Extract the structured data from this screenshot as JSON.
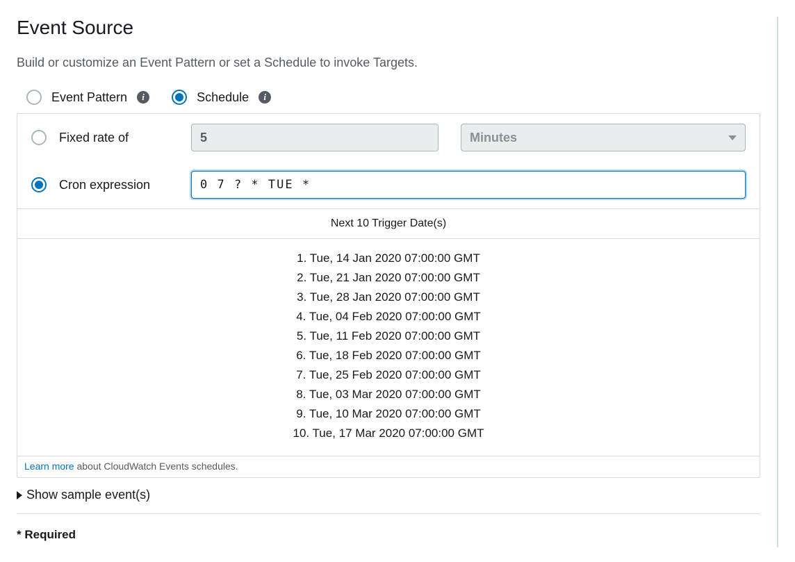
{
  "title": "Event Source",
  "description": "Build or customize an Event Pattern or set a Schedule to invoke Targets.",
  "sourceType": {
    "eventPattern": {
      "label": "Event Pattern",
      "selected": false
    },
    "schedule": {
      "label": "Schedule",
      "selected": true
    }
  },
  "schedule": {
    "fixedRate": {
      "label": "Fixed rate of",
      "selected": false,
      "value": "5",
      "unit": "Minutes"
    },
    "cron": {
      "label": "Cron expression",
      "selected": true,
      "value": "0 7 ? * TUE *"
    }
  },
  "triggers": {
    "header": "Next 10 Trigger Date(s)",
    "items": [
      "1. Tue, 14 Jan 2020 07:00:00 GMT",
      "2. Tue, 21 Jan 2020 07:00:00 GMT",
      "3. Tue, 28 Jan 2020 07:00:00 GMT",
      "4. Tue, 04 Feb 2020 07:00:00 GMT",
      "5. Tue, 11 Feb 2020 07:00:00 GMT",
      "6. Tue, 18 Feb 2020 07:00:00 GMT",
      "7. Tue, 25 Feb 2020 07:00:00 GMT",
      "8. Tue, 03 Mar 2020 07:00:00 GMT",
      "9. Tue, 10 Mar 2020 07:00:00 GMT",
      "10. Tue, 17 Mar 2020 07:00:00 GMT"
    ]
  },
  "learnMore": {
    "link": "Learn more",
    "text": " about CloudWatch Events schedules."
  },
  "expand": {
    "label": "Show sample event(s)"
  },
  "required": {
    "label": "* Required"
  }
}
